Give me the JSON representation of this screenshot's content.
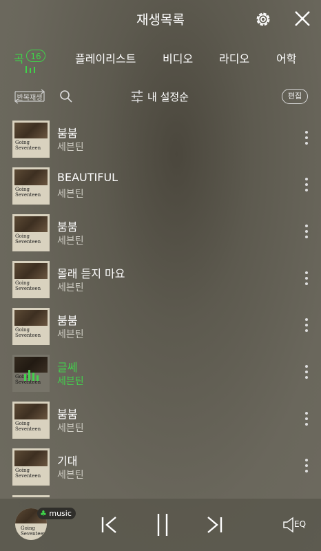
{
  "header": {
    "title": "재생목록"
  },
  "tabs": [
    {
      "label": "곡",
      "count": "16",
      "active": true
    },
    {
      "label": "플레이리스트"
    },
    {
      "label": "비디오"
    },
    {
      "label": "라디오"
    },
    {
      "label": "어학"
    }
  ],
  "toolbar": {
    "repeat_label": "반복재생",
    "sort_label": "내 설정순",
    "edit_label": "편집"
  },
  "album": {
    "line1": "Going",
    "line2": "Seventeen"
  },
  "songs": [
    {
      "title": "붐붐",
      "artist": "세븐틴"
    },
    {
      "title": "BEAUTIFUL",
      "artist": "세븐틴"
    },
    {
      "title": "붐붐",
      "artist": "세븐틴"
    },
    {
      "title": "몰래 듣지 마요",
      "artist": "세븐틴"
    },
    {
      "title": "붐붐",
      "artist": "세븐틴"
    },
    {
      "title": "글쎄",
      "artist": "세븐틴",
      "playing": true
    },
    {
      "title": "붐붐",
      "artist": "세븐틴"
    },
    {
      "title": "기대",
      "artist": "세븐틴"
    }
  ],
  "player": {
    "tag": "music",
    "eq_label": "EQ"
  },
  "colors": {
    "accent": "#3fd44a"
  }
}
